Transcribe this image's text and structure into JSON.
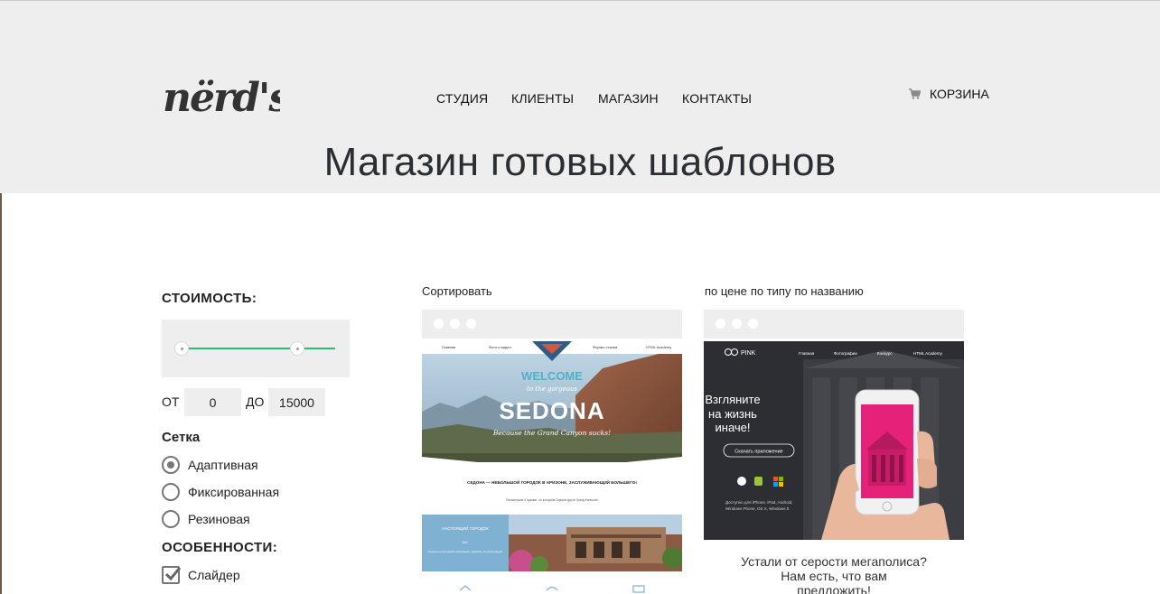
{
  "header": {
    "logo_text": "nërd's",
    "nav": [
      {
        "label": "СТУДИЯ"
      },
      {
        "label": "КЛИЕНТЫ"
      },
      {
        "label": "МАГАЗИН"
      },
      {
        "label": "КОНТАКТЫ"
      }
    ],
    "cart_label": "КОРЗИНА",
    "title": "Магазин готовых шаблонов"
  },
  "filters": {
    "price_heading": "СТОИМОСТЬ:",
    "price_range": {
      "min": 0,
      "max": 15000,
      "slider_low_fraction": 0.0,
      "slider_high_fraction": 0.75
    },
    "from_label": "ОТ",
    "from_value": "0",
    "to_label": "ДО",
    "to_value": "15000",
    "grid_heading": "Сетка",
    "grid_options": [
      {
        "label": "Адаптивная",
        "selected": true
      },
      {
        "label": "Фиксированная",
        "selected": false
      },
      {
        "label": "Резиновая",
        "selected": false
      }
    ],
    "features_heading": "ОСОБЕННОСТИ:",
    "features": [
      {
        "label": "Слайдер",
        "checked": true
      }
    ]
  },
  "sorting": {
    "label": "Сортировать",
    "options": [
      "по цене",
      "по типу",
      "по названию"
    ]
  },
  "products": [
    {
      "preview": {
        "nav": [
          "Главная",
          "Фото и видео",
          "Формы отзыва",
          "HTML Academy"
        ],
        "welcome": "WELCOME",
        "to_the": "to the gorgeous",
        "city": "SEDONA",
        "tagline": "Because the Grand Canyon sucks!",
        "subheading": "СЕДОНА — НЕБОЛЬШОЙ ГОРОДОК В АРИЗОНЕ, ЗАСЛУЖИВАЮЩИЙ БОЛЬШЕГО!",
        "small_text": "Рассмотрим 5 причин, по которым Седона круче Гранд Каньона!",
        "block_title": "НАСТОЯЩИЙ ГОРОДОК",
        "block_tag": "№1",
        "block_text": "Седона не испорчена массовым туризмом, не многолюдна"
      }
    },
    {
      "preview": {
        "brand": "PINK",
        "nav": [
          "Главная",
          "Фотографии",
          "Конкурс",
          "HTML Academy"
        ],
        "headline": [
          "Взгляните",
          "на жизнь",
          "иначе!"
        ],
        "button": "Скачать приложение",
        "platforms_text": [
          "Доступно для iPhone, iPad, Android,",
          "Windows Phone, OS X, Windows 8"
        ]
      },
      "description_lines": [
        "Устали от серости мегаполиса?",
        "Нам есть, что вам",
        "предложить!"
      ]
    }
  ],
  "colors": {
    "header_bg": "#eeeeee",
    "accent_green": "#2ebd6b",
    "pink": "#e6217a"
  }
}
